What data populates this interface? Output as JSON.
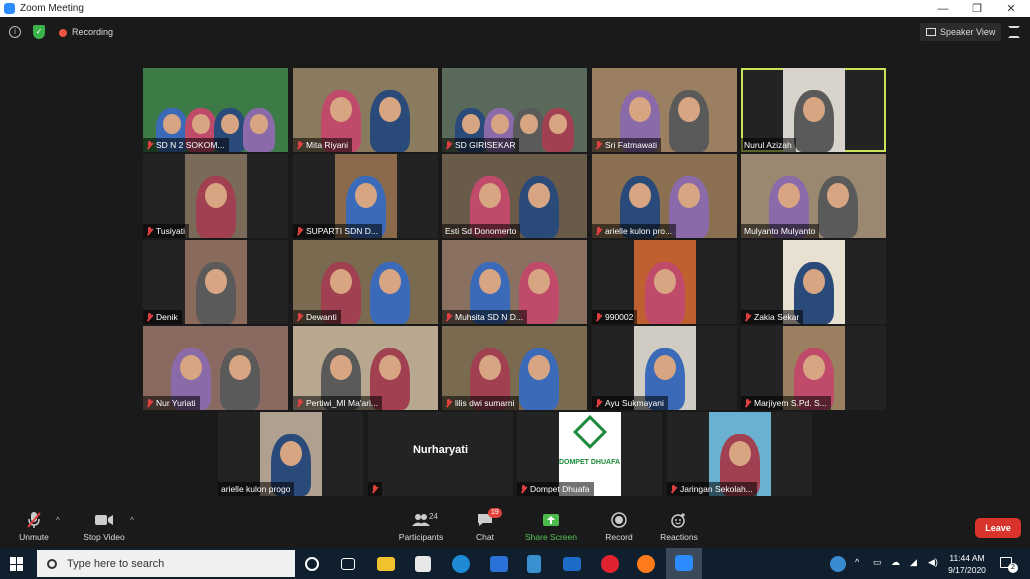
{
  "window": {
    "title": "Zoom Meeting",
    "minimize": "—",
    "maximize": "❐",
    "close": "✕"
  },
  "meeting_bar": {
    "info_icon": "info-icon",
    "encryption_icon": "shield-check-icon",
    "recording_label": "Recording",
    "view_label": "Speaker View"
  },
  "participants": [
    {
      "name": "SD N 2 SOKOM...",
      "muted": true,
      "speaking": false,
      "bg": "#3c7a46"
    },
    {
      "name": "Mita Riyani",
      "muted": true,
      "speaking": false,
      "bg": "#8a7a5e"
    },
    {
      "name": "SD GIRISEKAR",
      "muted": true,
      "speaking": false,
      "bg": "#5a6a5a"
    },
    {
      "name": "Sri Fatmawati",
      "muted": true,
      "speaking": false,
      "bg": "#9a8060"
    },
    {
      "name": "Nurul Azizah",
      "muted": false,
      "speaking": true,
      "bg": "#d8d4cc"
    },
    {
      "name": "Tusiyati",
      "muted": true,
      "speaking": false,
      "bg": "#7a6a5a"
    },
    {
      "name": "SUPARTI SDN D...",
      "muted": true,
      "speaking": false,
      "bg": "#8a6a4a"
    },
    {
      "name": "Esti Sd Donomerto",
      "muted": false,
      "speaking": false,
      "bg": "#6a5a4a"
    },
    {
      "name": "arielle kulon pro...",
      "muted": true,
      "speaking": false,
      "bg": "#8a7050"
    },
    {
      "name": "Mulyanto Mulyanto",
      "muted": false,
      "speaking": false,
      "bg": "#9a8870"
    },
    {
      "name": "Denik",
      "muted": true,
      "speaking": false,
      "bg": "#8a6a5a"
    },
    {
      "name": "Dewanti",
      "muted": true,
      "speaking": false,
      "bg": "#7a6a50"
    },
    {
      "name": "Muhsita SD N D...",
      "muted": true,
      "speaking": false,
      "bg": "#8a7060"
    },
    {
      "name": "990002",
      "muted": true,
      "speaking": false,
      "bg": "#c06030"
    },
    {
      "name": "Zakia Sekar",
      "muted": true,
      "speaking": false,
      "bg": "#e8e0d0"
    },
    {
      "name": "Nur Yuriati",
      "muted": true,
      "speaking": false,
      "bg": "#8a6a60"
    },
    {
      "name": "Pertiwi_MI Ma'ari...",
      "muted": true,
      "speaking": false,
      "bg": "#b8a890"
    },
    {
      "name": "lilis dwi sumarni",
      "muted": true,
      "speaking": false,
      "bg": "#7a6a50"
    },
    {
      "name": "Ayu Sukmayani",
      "muted": true,
      "speaking": false,
      "bg": "#d0ccc4"
    },
    {
      "name": "Marjiyem S.Pd. S...",
      "muted": true,
      "speaking": false,
      "bg": "#9a8060"
    },
    {
      "name": "arielle kulon progo",
      "muted": false,
      "speaking": false,
      "bg": "#b0a090"
    },
    {
      "name": "Nurharyati",
      "muted": true,
      "speaking": false,
      "bg": "#232323",
      "no_video": true
    },
    {
      "name": "Dompet Dhuafa",
      "muted": true,
      "speaking": false,
      "bg": "#ffffff",
      "logo": "DOMPET DHUAFA"
    },
    {
      "name": "Jaringan Sekolah...",
      "muted": true,
      "speaking": false,
      "bg": "#6ab0d0"
    }
  ],
  "toolbar": {
    "unmute_label": "Unmute",
    "stop_video_label": "Stop Video",
    "participants_label": "Participants",
    "participants_count": "24",
    "chat_label": "Chat",
    "chat_badge": "19",
    "share_label": "Share Screen",
    "record_label": "Record",
    "reactions_label": "Reactions",
    "leave_label": "Leave"
  },
  "taskbar": {
    "search_placeholder": "Type here to search",
    "time": "11:44 AM",
    "date": "9/17/2020",
    "notifications_count": "2"
  }
}
